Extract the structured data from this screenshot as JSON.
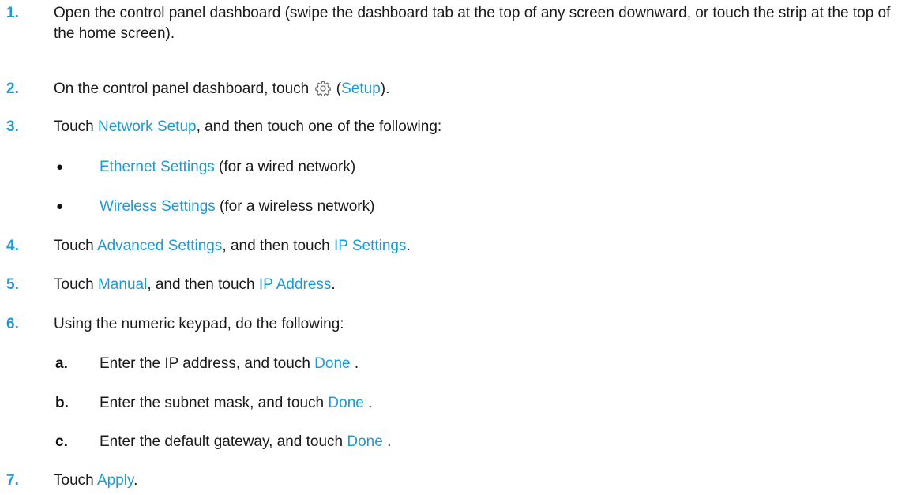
{
  "colors": {
    "accent": "#1d9ad6",
    "text": "#1a1a1a"
  },
  "steps": [
    {
      "number": "1.",
      "text": "Open the control panel dashboard (swipe the dashboard tab at the top of any screen downward, or touch the strip at the top of the home screen)."
    },
    {
      "number": "2.",
      "before": "On the control panel dashboard, touch",
      "icon": "gear-icon",
      "paren_open": " (",
      "link": "Setup",
      "after": ")."
    },
    {
      "number": "3.",
      "before": "Touch ",
      "link": "Network Setup",
      "after": ", and then touch one of the following:",
      "bullets": [
        {
          "link": "Ethernet Settings",
          "after": " (for a wired network)"
        },
        {
          "link": "Wireless Settings",
          "after": " (for a wireless network)"
        }
      ]
    },
    {
      "number": "4.",
      "before": "Touch ",
      "link": "Advanced Settings",
      "middle": ", and then touch ",
      "link2": "IP Settings",
      "after": "."
    },
    {
      "number": "5.",
      "before": "Touch ",
      "link": "Manual",
      "middle": ", and then touch ",
      "link2": "IP Address",
      "after": "."
    },
    {
      "number": "6.",
      "text": "Using the numeric keypad, do the following:",
      "substeps": [
        {
          "label": "a.",
          "before": "Enter the IP address, and touch ",
          "link": "Done",
          "after": " ."
        },
        {
          "label": "b.",
          "before": "Enter the subnet mask, and touch ",
          "link": "Done",
          "after": " ."
        },
        {
          "label": "c.",
          "before": "Enter the default gateway, and touch ",
          "link": "Done",
          "after": " ."
        }
      ]
    },
    {
      "number": "7.",
      "before": "Touch ",
      "link": "Apply",
      "after": "."
    }
  ]
}
